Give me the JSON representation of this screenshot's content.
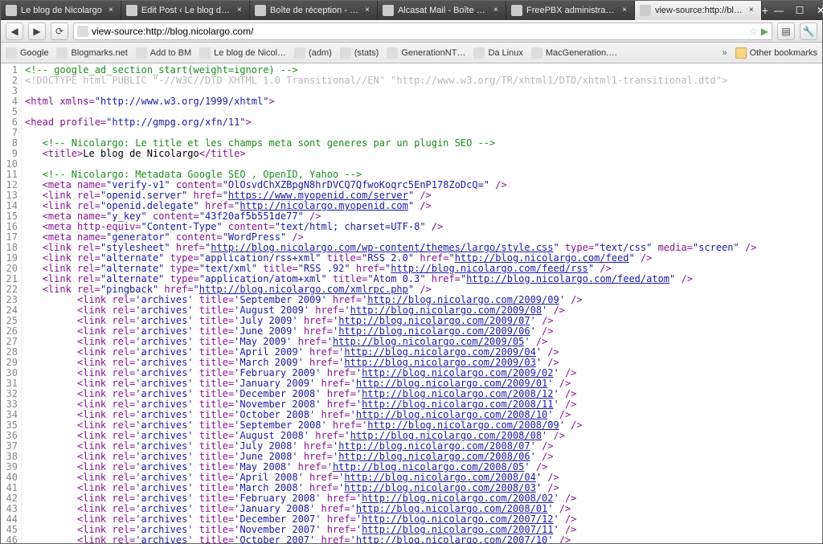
{
  "tabs": [
    {
      "label": "Le blog de Nicolargo",
      "active": false
    },
    {
      "label": "Edit Post ‹ Le blog de…",
      "active": false
    },
    {
      "label": "Boîte de réception - …",
      "active": false
    },
    {
      "label": "Alcasat Mail - Boîte d…",
      "active": false
    },
    {
      "label": "FreePBX administration",
      "active": false
    },
    {
      "label": "view-source:http://bl…",
      "active": true
    }
  ],
  "url": "view-source:http://blog.nicolargo.com/",
  "bookmarks": {
    "items": [
      "Google",
      "Blogmarks.net",
      "Add to BM",
      "Le blog de Nicol…",
      "(adm)",
      "(stats)",
      "GenerationNT…",
      "Da Linux",
      "MacGeneration.…"
    ],
    "other": "Other bookmarks"
  },
  "source_lines": [
    {
      "n": 1,
      "t": "comment",
      "text": "<!-- google_ad_section_start(weight=ignore) -->"
    },
    {
      "n": 2,
      "t": "dim",
      "text": "<!DOCTYPE html PUBLIC \"-//W3C//DTD XHTML 1.0 Transitional//EN\" \"http://www.w3.org/TR/xhtml1/DTD/xhtml1-transitional.dtd\">"
    },
    {
      "n": 3,
      "t": "blank",
      "text": ""
    },
    {
      "n": 4,
      "t": "tag",
      "parts": [
        {
          "k": "tg",
          "v": "<html"
        },
        {
          "k": "att",
          "v": " xmlns="
        },
        {
          "k": "str",
          "v": "\"http://www.w3.org/1999/xhtml\""
        },
        {
          "k": "tg",
          "v": ">"
        }
      ]
    },
    {
      "n": 5,
      "t": "blank",
      "text": ""
    },
    {
      "n": 6,
      "t": "tag",
      "parts": [
        {
          "k": "tg",
          "v": "<head"
        },
        {
          "k": "att",
          "v": " profile="
        },
        {
          "k": "str",
          "v": "\"http://gmpg.org/xfn/11\""
        },
        {
          "k": "tg",
          "v": ">"
        }
      ]
    },
    {
      "n": 7,
      "t": "blank",
      "text": ""
    },
    {
      "n": 8,
      "t": "comment",
      "indent": "   ",
      "text": "<!-- Nicolargo: Le title et les champs meta sont generes par un plugin SEO -->"
    },
    {
      "n": 9,
      "t": "tag",
      "indent": "   ",
      "parts": [
        {
          "k": "tg",
          "v": "<title>"
        },
        {
          "k": "txt",
          "v": "Le blog de Nicolargo"
        },
        {
          "k": "tg",
          "v": "</title>"
        }
      ]
    },
    {
      "n": 10,
      "t": "blank",
      "text": ""
    },
    {
      "n": 11,
      "t": "comment",
      "indent": "   ",
      "text": "<!-- Nicolargo: Metadata Google SEO , OpenID, Yahoo -->"
    },
    {
      "n": 12,
      "t": "tag",
      "indent": "   ",
      "parts": [
        {
          "k": "tg",
          "v": "<meta"
        },
        {
          "k": "att",
          "v": " name="
        },
        {
          "k": "str",
          "v": "\"verify-v1\""
        },
        {
          "k": "att",
          "v": " content="
        },
        {
          "k": "str",
          "v": "\"OlOsvdChXZBpgN8hrDVCQ7QfwoKoqrc5EnP178ZoDcQ=\""
        },
        {
          "k": "tg",
          "v": " />"
        }
      ]
    },
    {
      "n": 13,
      "t": "tag",
      "indent": "   ",
      "parts": [
        {
          "k": "tg",
          "v": "<link"
        },
        {
          "k": "att",
          "v": " rel="
        },
        {
          "k": "str",
          "v": "\"openid.server\""
        },
        {
          "k": "att",
          "v": " href="
        },
        {
          "k": "str",
          "v": "\""
        },
        {
          "k": "lnk",
          "v": "https://www.myopenid.com/server"
        },
        {
          "k": "str",
          "v": "\""
        },
        {
          "k": "tg",
          "v": " />"
        }
      ]
    },
    {
      "n": 14,
      "t": "tag",
      "indent": "   ",
      "parts": [
        {
          "k": "tg",
          "v": "<link"
        },
        {
          "k": "att",
          "v": " rel="
        },
        {
          "k": "str",
          "v": "\"openid.delegate\""
        },
        {
          "k": "att",
          "v": " href="
        },
        {
          "k": "str",
          "v": "\""
        },
        {
          "k": "lnk",
          "v": "http://nicolargo.myopenid.com"
        },
        {
          "k": "str",
          "v": "\""
        },
        {
          "k": "tg",
          "v": " />"
        }
      ]
    },
    {
      "n": 15,
      "t": "tag",
      "indent": "   ",
      "parts": [
        {
          "k": "tg",
          "v": "<meta"
        },
        {
          "k": "att",
          "v": " name="
        },
        {
          "k": "str",
          "v": "\"y_key\""
        },
        {
          "k": "att",
          "v": " content="
        },
        {
          "k": "str",
          "v": "\"43f20af5b551de77\""
        },
        {
          "k": "tg",
          "v": " />"
        }
      ]
    },
    {
      "n": 16,
      "t": "tag",
      "indent": "   ",
      "parts": [
        {
          "k": "tg",
          "v": "<meta"
        },
        {
          "k": "att",
          "v": " http-equiv="
        },
        {
          "k": "str",
          "v": "\"Content-Type\""
        },
        {
          "k": "att",
          "v": " content="
        },
        {
          "k": "str",
          "v": "\"text/html; charset=UTF-8\""
        },
        {
          "k": "tg",
          "v": " />"
        }
      ]
    },
    {
      "n": 17,
      "t": "tag",
      "indent": "   ",
      "parts": [
        {
          "k": "tg",
          "v": "<meta"
        },
        {
          "k": "att",
          "v": " name="
        },
        {
          "k": "str",
          "v": "\"generator\""
        },
        {
          "k": "att",
          "v": " content="
        },
        {
          "k": "str",
          "v": "\"WordPress\""
        },
        {
          "k": "tg",
          "v": " />"
        }
      ]
    },
    {
      "n": 18,
      "t": "tag",
      "indent": "   ",
      "parts": [
        {
          "k": "tg",
          "v": "<link"
        },
        {
          "k": "att",
          "v": " rel="
        },
        {
          "k": "str",
          "v": "\"stylesheet\""
        },
        {
          "k": "att",
          "v": " href="
        },
        {
          "k": "str",
          "v": "\""
        },
        {
          "k": "lnk",
          "v": "http://blog.nicolargo.com/wp-content/themes/largo/style.css"
        },
        {
          "k": "str",
          "v": "\""
        },
        {
          "k": "att",
          "v": " type="
        },
        {
          "k": "str",
          "v": "\"text/css\""
        },
        {
          "k": "att",
          "v": " media="
        },
        {
          "k": "str",
          "v": "\"screen\""
        },
        {
          "k": "tg",
          "v": " />"
        }
      ]
    },
    {
      "n": 19,
      "t": "tag",
      "indent": "   ",
      "parts": [
        {
          "k": "tg",
          "v": "<link"
        },
        {
          "k": "att",
          "v": " rel="
        },
        {
          "k": "str",
          "v": "\"alternate\""
        },
        {
          "k": "att",
          "v": " type="
        },
        {
          "k": "str",
          "v": "\"application/rss+xml\""
        },
        {
          "k": "att",
          "v": " title="
        },
        {
          "k": "str",
          "v": "\"RSS 2.0\""
        },
        {
          "k": "att",
          "v": " href="
        },
        {
          "k": "str",
          "v": "\""
        },
        {
          "k": "lnk",
          "v": "http://blog.nicolargo.com/feed"
        },
        {
          "k": "str",
          "v": "\""
        },
        {
          "k": "tg",
          "v": " />"
        }
      ]
    },
    {
      "n": 20,
      "t": "tag",
      "indent": "   ",
      "parts": [
        {
          "k": "tg",
          "v": "<link"
        },
        {
          "k": "att",
          "v": " rel="
        },
        {
          "k": "str",
          "v": "\"alternate\""
        },
        {
          "k": "att",
          "v": " type="
        },
        {
          "k": "str",
          "v": "\"text/xml\""
        },
        {
          "k": "att",
          "v": " title="
        },
        {
          "k": "str",
          "v": "\"RSS .92\""
        },
        {
          "k": "att",
          "v": " href="
        },
        {
          "k": "str",
          "v": "\""
        },
        {
          "k": "lnk",
          "v": "http://blog.nicolargo.com/feed/rss"
        },
        {
          "k": "str",
          "v": "\""
        },
        {
          "k": "tg",
          "v": " />"
        }
      ]
    },
    {
      "n": 21,
      "t": "tag",
      "indent": "   ",
      "parts": [
        {
          "k": "tg",
          "v": "<link"
        },
        {
          "k": "att",
          "v": " rel="
        },
        {
          "k": "str",
          "v": "\"alternate\""
        },
        {
          "k": "att",
          "v": " type="
        },
        {
          "k": "str",
          "v": "\"application/atom+xml\""
        },
        {
          "k": "att",
          "v": " title="
        },
        {
          "k": "str",
          "v": "\"Atom 0.3\""
        },
        {
          "k": "att",
          "v": " href="
        },
        {
          "k": "str",
          "v": "\""
        },
        {
          "k": "lnk",
          "v": "http://blog.nicolargo.com/feed/atom"
        },
        {
          "k": "str",
          "v": "\""
        },
        {
          "k": "tg",
          "v": " />"
        }
      ]
    },
    {
      "n": 22,
      "t": "tag",
      "indent": "   ",
      "parts": [
        {
          "k": "tg",
          "v": "<link"
        },
        {
          "k": "att",
          "v": " rel="
        },
        {
          "k": "str",
          "v": "\"pingback\""
        },
        {
          "k": "att",
          "v": " href="
        },
        {
          "k": "str",
          "v": "\""
        },
        {
          "k": "lnk",
          "v": "http://blog.nicolargo.com/xmlrpc.php"
        },
        {
          "k": "str",
          "v": "\""
        },
        {
          "k": "tg",
          "v": " />"
        }
      ]
    },
    {
      "n": 23,
      "t": "archive",
      "month": "September 2009",
      "url": "http://blog.nicolargo.com/2009/09"
    },
    {
      "n": 24,
      "t": "archive",
      "month": "August 2009",
      "url": "http://blog.nicolargo.com/2009/08"
    },
    {
      "n": 25,
      "t": "archive",
      "month": "July 2009",
      "url": "http://blog.nicolargo.com/2009/07"
    },
    {
      "n": 26,
      "t": "archive",
      "month": "June 2009",
      "url": "http://blog.nicolargo.com/2009/06"
    },
    {
      "n": 27,
      "t": "archive",
      "month": "May 2009",
      "url": "http://blog.nicolargo.com/2009/05"
    },
    {
      "n": 28,
      "t": "archive",
      "month": "April 2009",
      "url": "http://blog.nicolargo.com/2009/04"
    },
    {
      "n": 29,
      "t": "archive",
      "month": "March 2009",
      "url": "http://blog.nicolargo.com/2009/03"
    },
    {
      "n": 30,
      "t": "archive",
      "month": "February 2009",
      "url": "http://blog.nicolargo.com/2009/02"
    },
    {
      "n": 31,
      "t": "archive",
      "month": "January 2009",
      "url": "http://blog.nicolargo.com/2009/01"
    },
    {
      "n": 32,
      "t": "archive",
      "month": "December 2008",
      "url": "http://blog.nicolargo.com/2008/12"
    },
    {
      "n": 33,
      "t": "archive",
      "month": "November 2008",
      "url": "http://blog.nicolargo.com/2008/11"
    },
    {
      "n": 34,
      "t": "archive",
      "month": "October 2008",
      "url": "http://blog.nicolargo.com/2008/10"
    },
    {
      "n": 35,
      "t": "archive",
      "month": "September 2008",
      "url": "http://blog.nicolargo.com/2008/09"
    },
    {
      "n": 36,
      "t": "archive",
      "month": "August 2008",
      "url": "http://blog.nicolargo.com/2008/08"
    },
    {
      "n": 37,
      "t": "archive",
      "month": "July 2008",
      "url": "http://blog.nicolargo.com/2008/07"
    },
    {
      "n": 38,
      "t": "archive",
      "month": "June 2008",
      "url": "http://blog.nicolargo.com/2008/06"
    },
    {
      "n": 39,
      "t": "archive",
      "month": "May 2008",
      "url": "http://blog.nicolargo.com/2008/05"
    },
    {
      "n": 40,
      "t": "archive",
      "month": "April 2008",
      "url": "http://blog.nicolargo.com/2008/04"
    },
    {
      "n": 41,
      "t": "archive",
      "month": "March 2008",
      "url": "http://blog.nicolargo.com/2008/03"
    },
    {
      "n": 42,
      "t": "archive",
      "month": "February 2008",
      "url": "http://blog.nicolargo.com/2008/02"
    },
    {
      "n": 43,
      "t": "archive",
      "month": "January 2008",
      "url": "http://blog.nicolargo.com/2008/01"
    },
    {
      "n": 44,
      "t": "archive",
      "month": "December 2007",
      "url": "http://blog.nicolargo.com/2007/12"
    },
    {
      "n": 45,
      "t": "archive",
      "month": "November 2007",
      "url": "http://blog.nicolargo.com/2007/11"
    },
    {
      "n": 46,
      "t": "archive",
      "month": "October 2007",
      "url": "http://blog.nicolargo.com/2007/10"
    }
  ]
}
